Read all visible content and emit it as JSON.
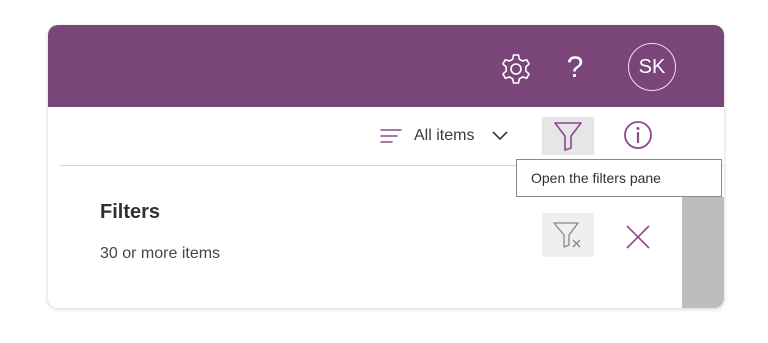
{
  "header": {
    "settings_icon": "gear-icon",
    "help_label": "?",
    "avatar_initials": "SK"
  },
  "toolbar": {
    "view_icon": "lines-icon",
    "view_label": "All items",
    "dropdown_icon": "chevron-down-icon",
    "filter_icon": "funnel-icon",
    "info_icon": "info-icon"
  },
  "tooltip": {
    "text": "Open the filters pane"
  },
  "filters_pane": {
    "title": "Filters",
    "count": "30 or more items",
    "clear_icon": "funnel-clear-icon",
    "close_icon": "close-icon"
  },
  "colors": {
    "suitebar": "#7a4579",
    "accent": "#8b4a8a",
    "text": "#323130"
  }
}
